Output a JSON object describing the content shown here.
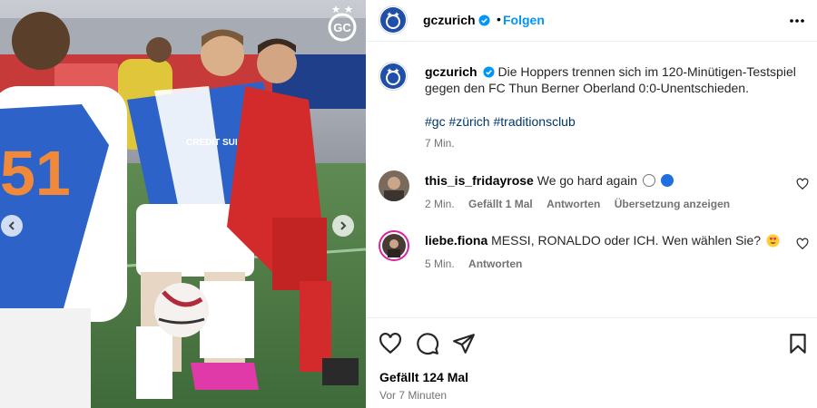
{
  "post": {
    "author": "gczurich",
    "follow_label": "Folgen",
    "separator": "•"
  },
  "caption": {
    "author": "gczurich",
    "text": "Die Hoppers trennen sich im 120-Minütigen-Testspiel gegen den FC Thun Berner Oberland 0:0-Unentschieden.",
    "hashtags": "#gc #zürich #traditionsclub",
    "time": "7 Min."
  },
  "comments": [
    {
      "user": "this_is_fridayrose",
      "text": "We go hard again",
      "time": "2 Min.",
      "likes": "Gefällt 1 Mal",
      "reply": "Antworten",
      "translate": "Übersetzung anzeigen"
    },
    {
      "user": "liebe.fiona",
      "text": "MESSI, RONALDO oder ICH. Wen wählen Sie?",
      "time": "5 Min.",
      "reply": "Antworten"
    }
  ],
  "footer": {
    "likes": "Gefällt 124 Mal",
    "date": "Vor 7 Minuten"
  },
  "media": {
    "player_number": "51",
    "sponsor": "CREDIT SUISSE",
    "badge_text": "GC"
  },
  "colors": {
    "link_blue": "#0095f6",
    "hashtag": "#00376b",
    "gc_blue": "#1f4fa8",
    "thun_red": "#d32b2b"
  },
  "icons": [
    "verified-badge-icon",
    "more-options-icon",
    "heart-icon",
    "comment-icon",
    "share-icon",
    "bookmark-icon",
    "chevron-left-icon",
    "chevron-right-icon"
  ]
}
